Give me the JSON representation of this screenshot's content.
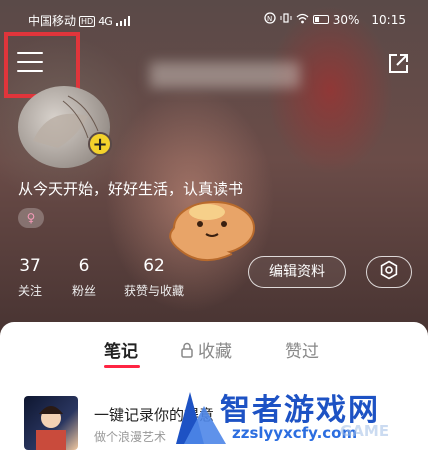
{
  "status_bar": {
    "carrier": "中国移动",
    "hd_badge": "HD",
    "network": "4G",
    "battery": "30%",
    "time": "10:15"
  },
  "profile": {
    "bio": "从今天开始，好好生活，认真读书",
    "gender_symbol": "♀",
    "avatar_badge": "+"
  },
  "stats": [
    {
      "num": "37",
      "label": "关注"
    },
    {
      "num": "6",
      "label": "粉丝"
    },
    {
      "num": "62",
      "label": "获赞与收藏"
    }
  ],
  "actions": {
    "edit_profile": "编辑资料"
  },
  "tabs": [
    {
      "label": "笔记",
      "active": true
    },
    {
      "label": "收藏",
      "active": false,
      "locked": true
    },
    {
      "label": "赞过",
      "active": false
    }
  ],
  "note": {
    "title": "一键记录你的得意",
    "subtitle": "做个浪漫艺术"
  },
  "watermark": {
    "title": "智者游戏网",
    "url": "zzslyyxcfy.com",
    "extra": "GAME"
  },
  "colors": {
    "accent": "#ff2442",
    "highlight_box": "#e0353b",
    "badge_yellow": "#f4d22b"
  },
  "icons": [
    "menu-icon",
    "share-icon",
    "settings-icon",
    "lock-icon",
    "plus-icon",
    "female-icon"
  ]
}
